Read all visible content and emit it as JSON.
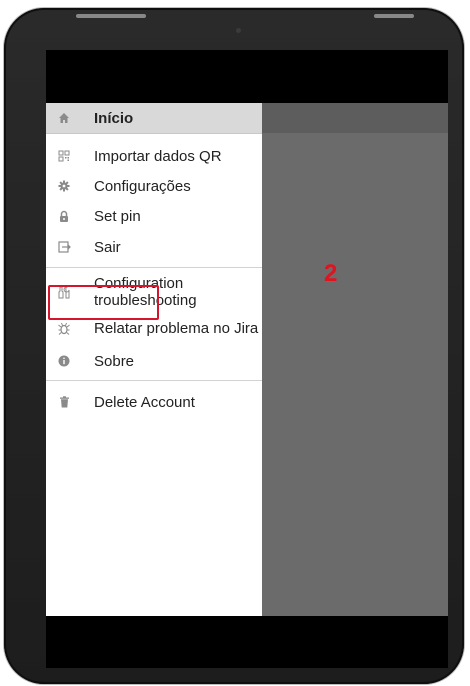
{
  "drawer": {
    "header": {
      "label": "Início",
      "icon": "home-icon"
    },
    "items": [
      {
        "label": "Importar dados QR",
        "icon": "qr-code-icon"
      },
      {
        "label": "Configurações",
        "icon": "gear-icon"
      },
      {
        "label": "Set pin",
        "icon": "lock-icon"
      },
      {
        "label": "Sair",
        "icon": "logout-icon"
      },
      {
        "label": "Configuration troubleshooting",
        "icon": "tools-icon"
      },
      {
        "label": "Relatar problema no Jira",
        "icon": "bug-icon"
      },
      {
        "label": "Sobre",
        "icon": "info-icon"
      },
      {
        "label": "Delete Account",
        "icon": "trash-icon"
      }
    ]
  },
  "annotation": {
    "step_number": "2",
    "highlight_color": "#d3162b"
  },
  "colors": {
    "overlay": "#6b6b6b",
    "header_bg": "#d9d9d9",
    "icon_gray": "#8a8a8a"
  }
}
